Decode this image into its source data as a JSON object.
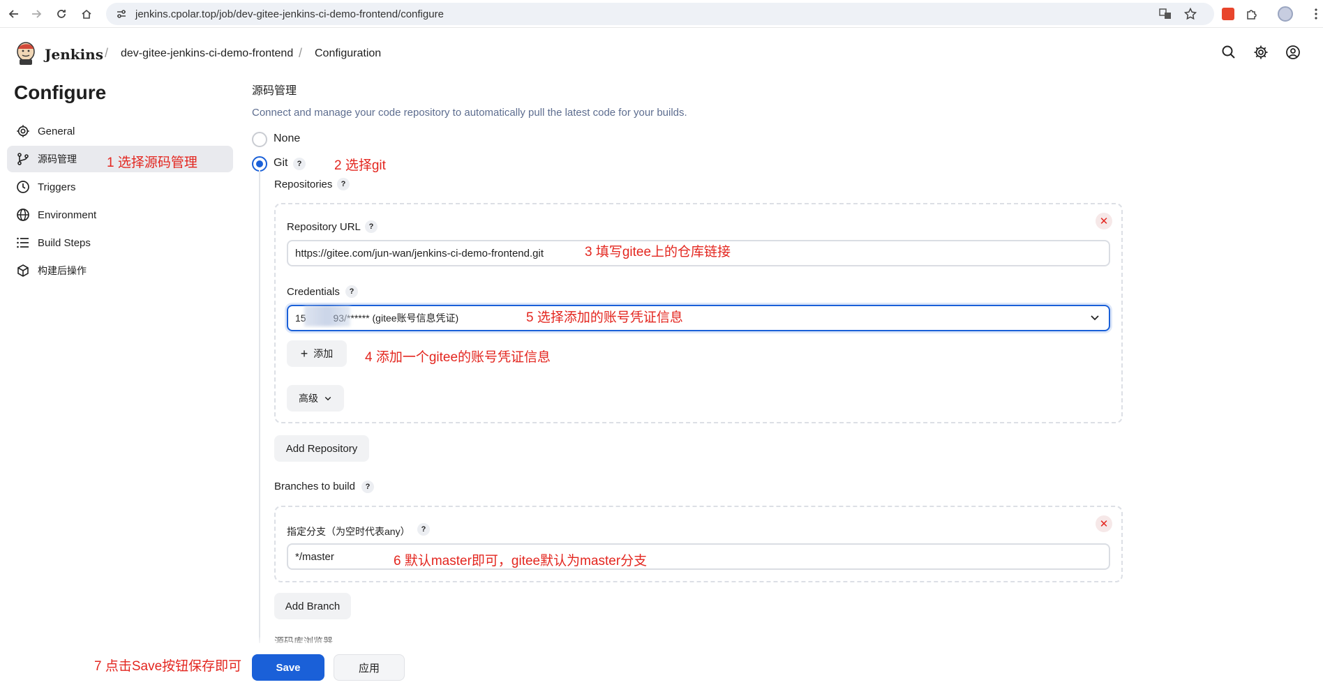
{
  "browser": {
    "url": "jenkins.cpolar.top/job/dev-gitee-jenkins-ci-demo-frontend/configure"
  },
  "header": {
    "brand": "Jenkins",
    "breadcrumbs": [
      "dev-gitee-jenkins-ci-demo-frontend",
      "Configuration"
    ]
  },
  "sidebar": {
    "title": "Configure",
    "items": [
      {
        "label": "General",
        "icon": "gear-icon"
      },
      {
        "label": "源码管理",
        "icon": "git-branch-icon"
      },
      {
        "label": "Triggers",
        "icon": "clock-icon"
      },
      {
        "label": "Environment",
        "icon": "globe-icon"
      },
      {
        "label": "Build Steps",
        "icon": "list-icon"
      },
      {
        "label": "构建后操作",
        "icon": "package-icon"
      }
    ]
  },
  "scm": {
    "title": "源码管理",
    "description": "Connect and manage your code repository to automatically pull the latest code for your builds.",
    "options": [
      "None",
      "Git"
    ],
    "selected": "Git",
    "repositories_label": "Repositories",
    "repository_url_label": "Repository URL",
    "repository_url_value": "https://gitee.com/jun-wan/jenkins-ci-demo-frontend.git",
    "credentials_label": "Credentials",
    "credentials_value": "15          93/****** (gitee账号信息凭证)",
    "add_label": "添加",
    "advanced_label": "高级",
    "add_repository_label": "Add Repository",
    "branches_label": "Branches to build",
    "branch_spec_label": "指定分支（为空时代表any）",
    "branch_spec_value": "*/master",
    "add_branch_label": "Add Branch",
    "next_section_partial": "源码库浏览器"
  },
  "footer": {
    "save_label": "Save",
    "apply_label": "应用"
  },
  "annotations": {
    "a1": "1 选择源码管理",
    "a2": "2 选择git",
    "a3": "3 填写gitee上的仓库链接",
    "a4": "4 添加一个gitee的账号凭证信息",
    "a5": "5 选择添加的账号凭证信息",
    "a6": "6 默认master即可，gitee默认为master分支",
    "a7": "7 点击Save按钮保存即可"
  },
  "colors": {
    "accent": "#1a60d8",
    "annotation": "#e3261f"
  }
}
